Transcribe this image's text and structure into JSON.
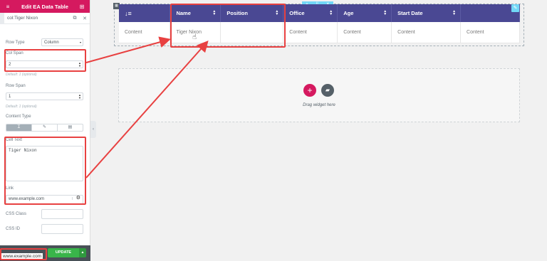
{
  "panel": {
    "header_title": "Edit EA Data Table",
    "breadcrumb": "col:Tiger Nixon",
    "row_type_label": "Row Type",
    "row_type_value": "Column",
    "col_span_label": "Col Span",
    "col_span_value": "2",
    "col_span_help": "Default: 1 (optional)",
    "row_span_label": "Row Span",
    "row_span_value": "1",
    "row_span_help": "Default: 1 (optional)",
    "content_type_label": "Content Type",
    "content_type_options": [
      "text-icon",
      "pencil-icon",
      "document-icon"
    ],
    "cell_text_label": "Cell Text",
    "cell_text_value": "Tiger Nixon",
    "link_label": "Link",
    "link_value": "www.example.com",
    "css_class_label": "CSS Class",
    "css_id_label": "CSS ID",
    "update_label": "UPDATE",
    "footer_url": "www.example.com"
  },
  "table": {
    "headers": [
      "",
      "Name",
      "Position",
      "Office",
      "Age",
      "Start Date",
      ""
    ],
    "row": [
      "Content",
      "Tiger Nixon",
      "",
      "Content",
      "Content",
      "Content",
      "Content"
    ]
  },
  "canvas": {
    "drag_text": "Drag widget here"
  },
  "colors": {
    "brand": "#d5195f",
    "table_header": "#4a4893",
    "annotation": "#e84141",
    "update_button": "#39b54a"
  }
}
